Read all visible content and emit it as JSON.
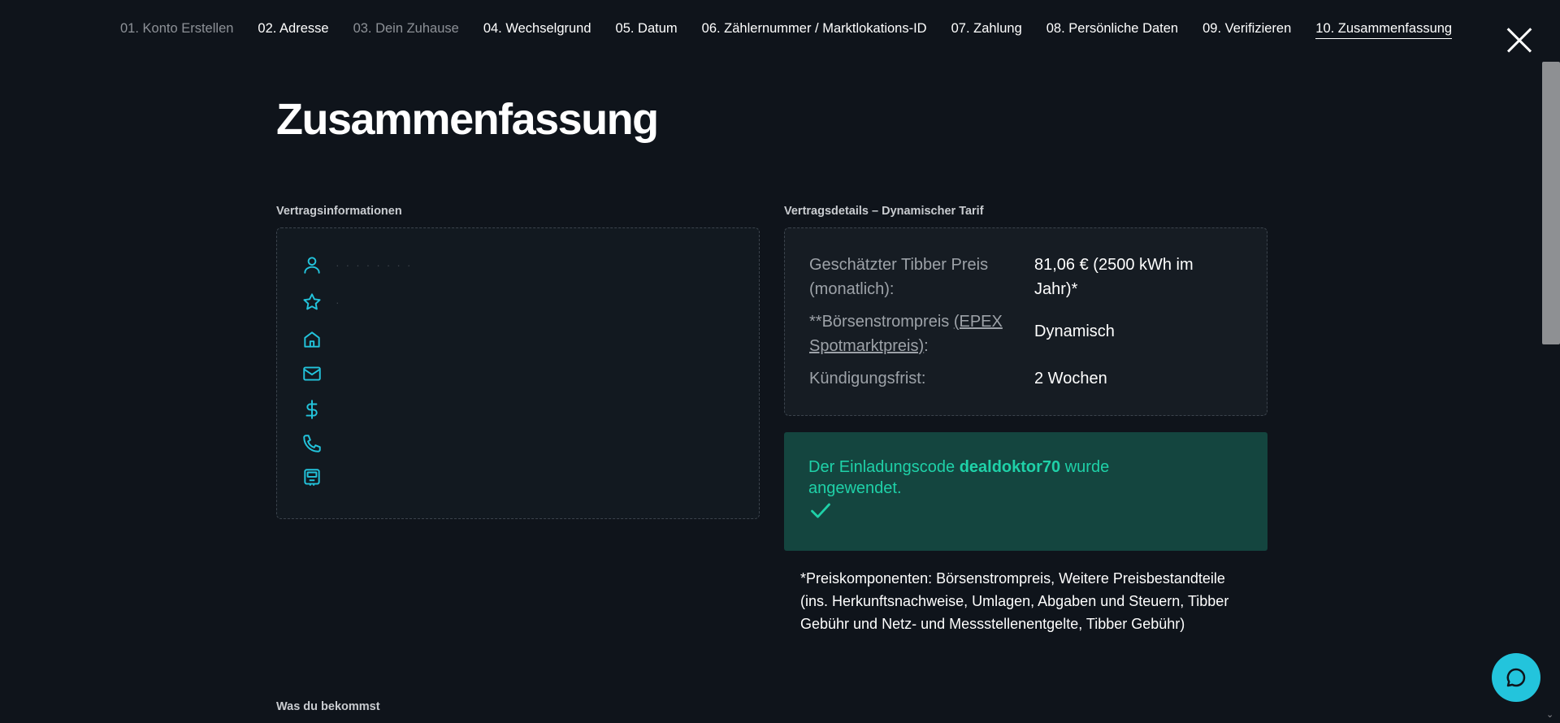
{
  "steps": [
    {
      "label": "01. Konto Erstellen",
      "state": "muted"
    },
    {
      "label": "02. Adresse",
      "state": "done"
    },
    {
      "label": "03. Dein Zuhause",
      "state": "muted"
    },
    {
      "label": "04. Wechselgrund",
      "state": "done"
    },
    {
      "label": "05. Datum",
      "state": "done"
    },
    {
      "label": "06. Zählernummer / Marktlokations-ID",
      "state": "done"
    },
    {
      "label": "07. Zahlung",
      "state": "done"
    },
    {
      "label": "08. Persönliche Daten",
      "state": "done"
    },
    {
      "label": "09. Verifizieren",
      "state": "done"
    },
    {
      "label": "10. Zusammenfassung",
      "state": "active"
    }
  ],
  "page_title": "Zusammenfassung",
  "contract_info": {
    "heading": "Vertragsinformationen",
    "rows": [
      {
        "icon": "user-icon",
        "text": "·  ·  ·  ·  ·  ·  ·  ·"
      },
      {
        "icon": "star-icon",
        "text": "·"
      },
      {
        "icon": "home-icon",
        "text": ""
      },
      {
        "icon": "mail-icon",
        "text": ""
      },
      {
        "icon": "dollar-icon",
        "text": ""
      },
      {
        "icon": "phone-icon",
        "text": ""
      },
      {
        "icon": "meter-icon",
        "text": ""
      }
    ]
  },
  "contract_details": {
    "heading": "Vertragsdetails – Dynamischer Tarif",
    "price_label": "Geschätzter Tibber Preis (monatlich):",
    "price_value": "81,06 € (2500 kWh im Jahr)*",
    "spot_label_prefix": "**Börsenstrompreis ",
    "spot_link": "(EPEX Spotmarktpreis)",
    "spot_label_suffix": ":",
    "spot_value": "Dynamisch",
    "notice_label": "Kündigungsfrist:",
    "notice_value": "2 Wochen"
  },
  "invite": {
    "prefix": "Der Einladungscode ",
    "code": "dealdoktor70",
    "suffix": " wurde angewendet."
  },
  "footnote": "*Preiskomponenten: Börsenstrompreis, Weitere Preisbestandteile (ins. Herkunftsnachweise, Umlagen, Abgaben und Steuern, Tibber Gebühr und Netz- und Messstellenentgelte, Tibber Gebühr)",
  "what_you_get_heading": "Was du bekommst",
  "colors": {
    "background": "#0f141b",
    "accent": "#23c4dc",
    "success": "#1fd1a8",
    "success_bg": "#14453f"
  }
}
